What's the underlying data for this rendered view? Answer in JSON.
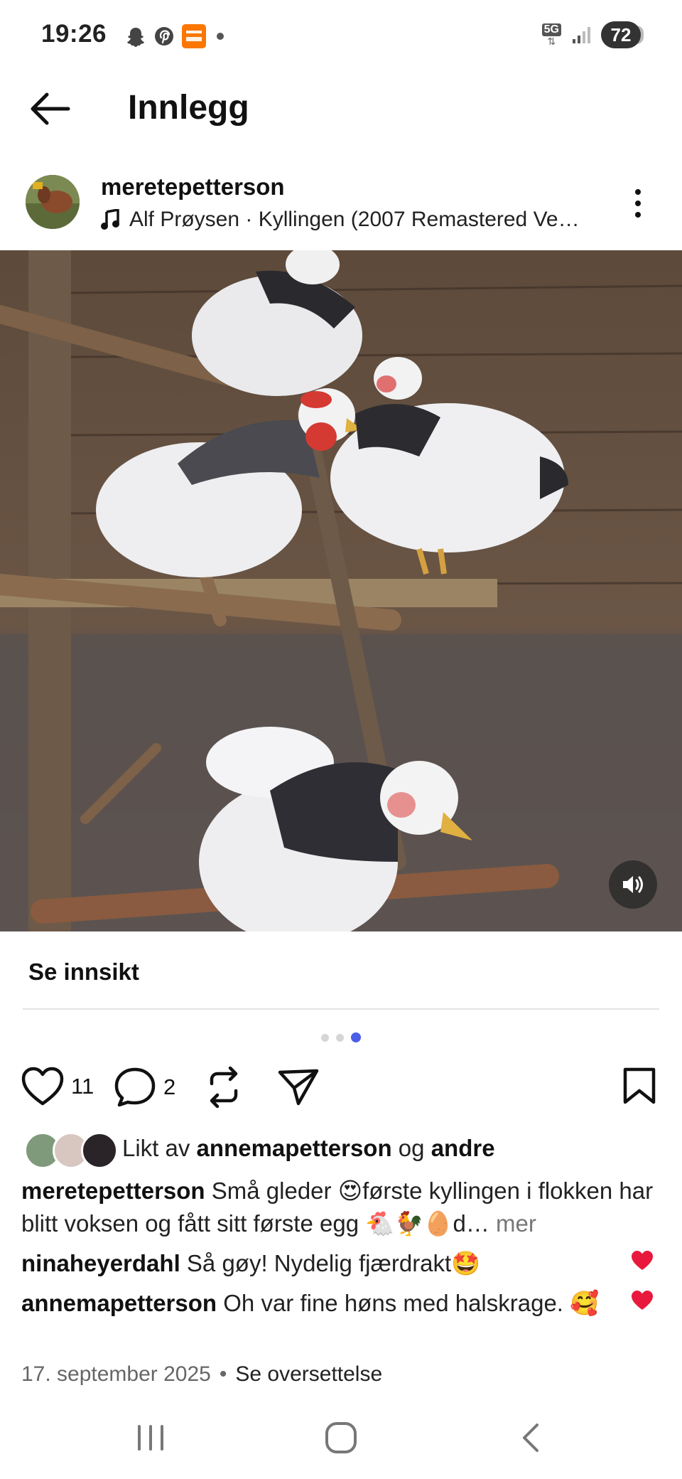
{
  "status_bar": {
    "time": "19:26",
    "network": "5G",
    "battery": "72",
    "notification_icons": [
      "snapchat-icon",
      "pinterest-icon",
      "temu-icon",
      "dot-icon"
    ]
  },
  "header": {
    "title": "Innlegg"
  },
  "post": {
    "username": "meretepetterson",
    "music": "Alf Prøysen · Kyllingen (2007 Remastered Ve…",
    "insight_label": "Se innsikt",
    "carousel": {
      "count": 3,
      "active_index": 3
    },
    "likes_count": "11",
    "comments_count": "2",
    "liked_by_prefix": "Likt av",
    "liked_by_user": "annemapetterson",
    "liked_by_joiner": "og",
    "liked_by_others": "andre",
    "caption_username": "meretepetterson",
    "caption_text": "Små gleder 😍første kyllingen i flokken har blitt voksen og fått sitt første egg 🐔🐓🥚d…",
    "caption_more": "mer",
    "comments": [
      {
        "username": "ninaheyerdahl",
        "text": "Så gøy! Nydelig fjærdrakt🤩",
        "liked": true
      },
      {
        "username": "annemapetterson",
        "text": "Oh var fine høns med halskrage. 🥰",
        "liked": true
      }
    ],
    "date": "17. september 2025",
    "separator": "•",
    "translate_label": "Se oversettelse"
  },
  "colors": {
    "accent": "#4a5ee8",
    "like_red": "#e8193c"
  }
}
